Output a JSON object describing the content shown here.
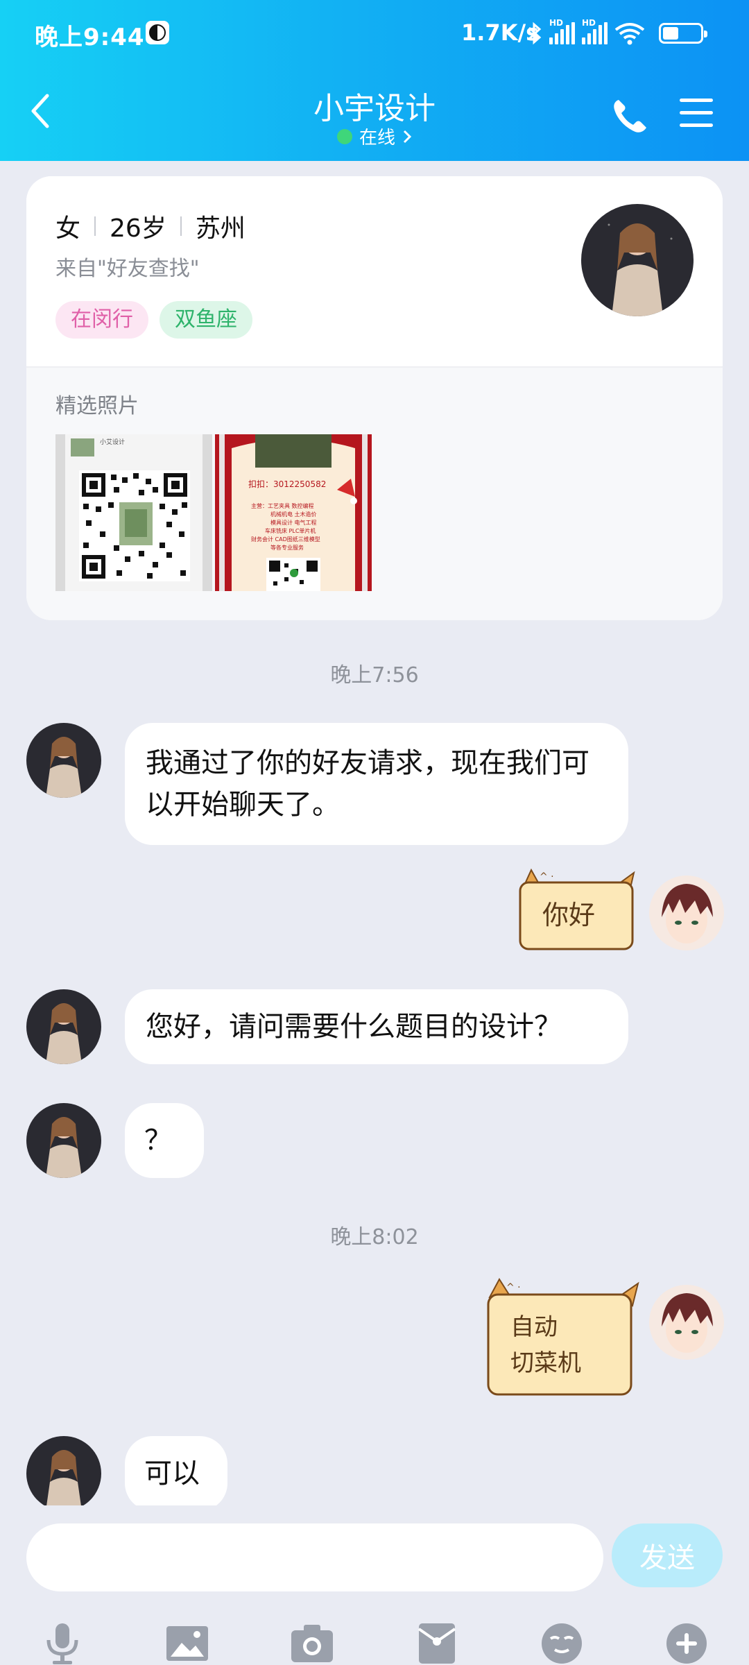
{
  "status_bar": {
    "time": "晚上9:44",
    "net_speed": "1.7K/s",
    "sim_label": "HD"
  },
  "nav": {
    "title": "小宇设计",
    "status": "在线"
  },
  "profile": {
    "gender": "女",
    "age": "26岁",
    "city": "苏州",
    "source": "来自\"好友查找\"",
    "tags": [
      "在闵行",
      "双鱼座"
    ],
    "photos_label": "精选照片",
    "photo1_caption": "小艾设计",
    "photo2_qq": "扣扣：3012250582",
    "photo2_lines": [
      "主营：工艺夹具 数控编程",
      "机械机电 土木造价",
      "模具设计 电气工程",
      "车床铣床 PLC单片机",
      "财务会计 CAD图纸三维模型",
      "等各专业服务"
    ]
  },
  "messages": [
    {
      "timestamp": "晚上7:56"
    },
    {
      "from": "other",
      "text": "我通过了你的好友请求，现在我们可以开始聊天了。"
    },
    {
      "from": "me",
      "sticker_text": "你好"
    },
    {
      "from": "other",
      "text": "您好，请问需要什么题目的设计？"
    },
    {
      "from": "other",
      "text": "？"
    },
    {
      "timestamp": "晚上8:02"
    },
    {
      "from": "me",
      "sticker_text": "自动切菜机"
    },
    {
      "from": "other",
      "text": "可以"
    }
  ],
  "input": {
    "placeholder": "",
    "send_label": "发送"
  },
  "toolbar": [
    "mic-icon",
    "image-icon",
    "camera-icon",
    "red-packet-icon",
    "emoji-icon",
    "plus-icon"
  ],
  "colors": {
    "header_start": "#16D0F5",
    "header_end": "#0C92F4",
    "background": "#E9EBF3",
    "send_disabled": "#B9ECFB",
    "online": "#3FD67A"
  }
}
